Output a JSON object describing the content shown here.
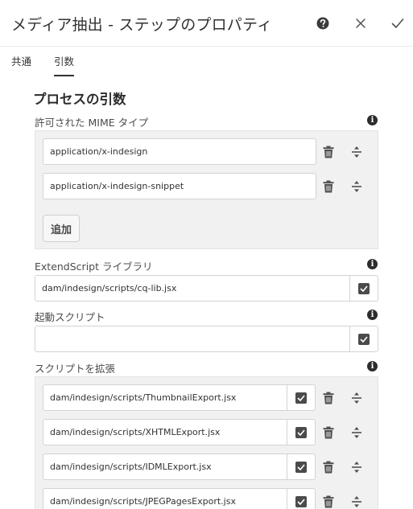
{
  "header": {
    "title": "メディア抽出 - ステップのプロパティ"
  },
  "tabs": [
    {
      "label": "共通"
    },
    {
      "label": "引数"
    }
  ],
  "section": {
    "title": "プロセスの引数"
  },
  "mime": {
    "label": "許可された MIME タイプ",
    "items": [
      "application/x-indesign",
      "application/x-indesign-snippet"
    ],
    "add_label": "追加"
  },
  "extendscript": {
    "label": "ExtendScript ライブラリ",
    "value": "dam/indesign/scripts/cq-lib.jsx"
  },
  "startup": {
    "label": "起動スクリプト",
    "value": ""
  },
  "extend": {
    "label": "スクリプトを拡張",
    "items": [
      "dam/indesign/scripts/ThumbnailExport.jsx",
      "dam/indesign/scripts/XHTMLExport.jsx",
      "dam/indesign/scripts/IDMLExport.jsx",
      "dam/indesign/scripts/JPEGPagesExport.jsx"
    ]
  },
  "info_glyph": "i"
}
